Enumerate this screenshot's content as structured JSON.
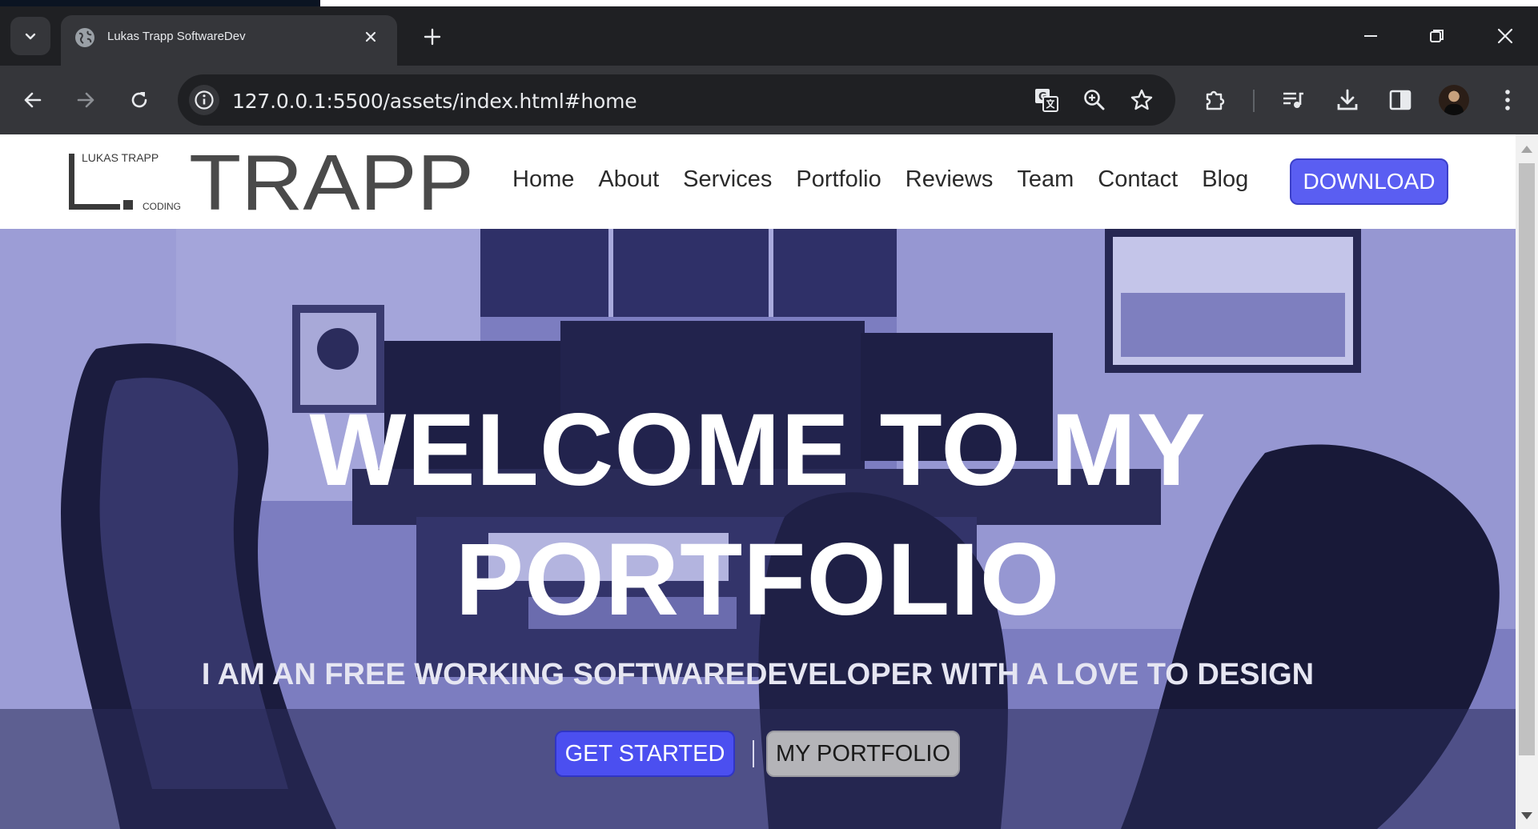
{
  "browser": {
    "tab_title": "Lukas Trapp SoftwareDev",
    "url": "127.0.0.1:5500/assets/index.html#home",
    "icons": {
      "tab_search": "chevron-down-icon",
      "favicon": "globe-icon",
      "tab_close": "close-icon",
      "new_tab": "plus-icon",
      "minimize": "minimize-icon",
      "restore": "restore-icon",
      "close": "close-icon",
      "back": "arrow-left-icon",
      "forward": "arrow-right-icon",
      "reload": "reload-icon",
      "site_info": "info-icon",
      "translate": "translate-icon",
      "zoom": "zoom-icon",
      "bookmark": "star-icon",
      "extensions": "puzzle-icon",
      "media": "media-queue-icon",
      "downloads": "download-icon",
      "side_panel": "side-panel-icon",
      "menu": "kebab-menu-icon"
    }
  },
  "site": {
    "logo": {
      "top_text": "LUKAS TRAPP",
      "bottom_text": "CODING",
      "letter": "L.",
      "word": "TRAPP"
    },
    "nav": [
      "Home",
      "About",
      "Services",
      "Portfolio",
      "Reviews",
      "Team",
      "Contact",
      "Blog"
    ],
    "download_label": "DOWNLOAD",
    "accent": "#5a5ef2"
  },
  "hero": {
    "title_line1": "WELCOME TO MY",
    "title_line2": "PORTFOLIO",
    "subtitle": "I AM AN FREE WORKING SOFTWAREDEVELOPER WITH A LOVE TO DESIGN",
    "primary_button": "GET STARTED",
    "secondary_button": "MY PORTFOLIO"
  }
}
